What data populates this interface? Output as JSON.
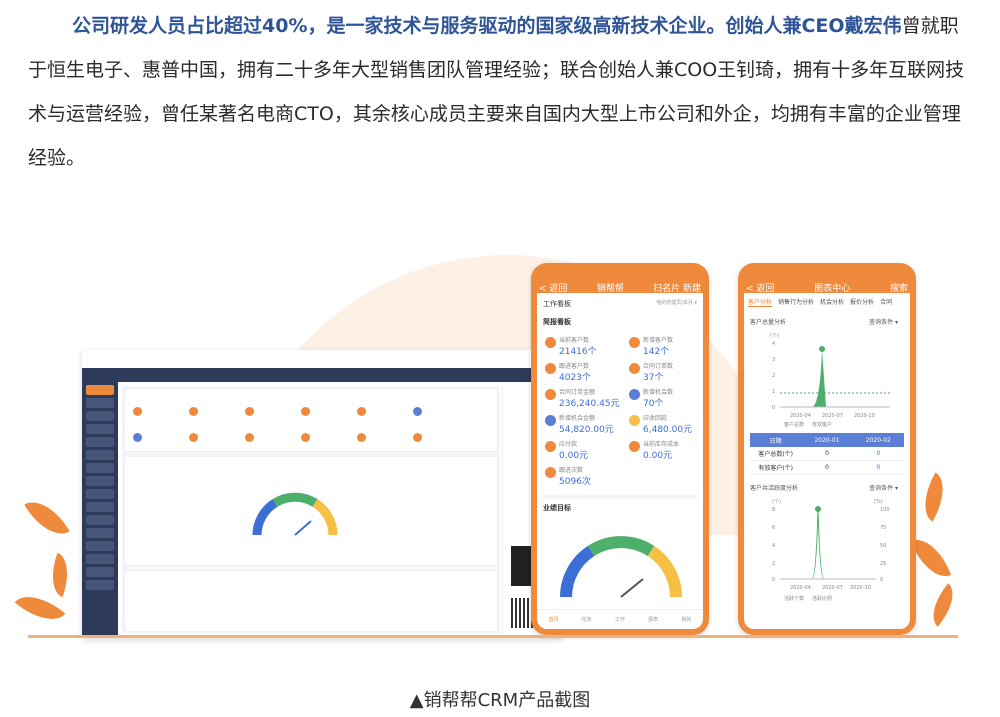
{
  "article": {
    "bold_lead": "公司研发人员占比超过40%，是一家技术与服务驱动的国家级高新技术企业。创始人兼CEO",
    "ceo_name": "戴宏伟",
    "text": "曾就职于恒生电子、惠普中国，拥有二十多年大型销售团队管理经验；联合创始人兼COO王钊琦，拥有十多年互联网技术与运营经验，曾任某著名电商CTO，其余核心成员主要来自国内大型上市公司和外企，均拥有丰富的企业管理经验。"
  },
  "phone1": {
    "back": "< 返回",
    "title": "销帮帮",
    "right": "扫名片  新建",
    "section1": "工作看板",
    "section1_right": "他的管理员/本月 ▾",
    "section2": "简报看板",
    "kpis": [
      {
        "label": "当前客户数",
        "value": "21416个"
      },
      {
        "label": "新增客户数",
        "value": "142个"
      },
      {
        "label": "跟进客户数",
        "value": "4023个"
      },
      {
        "label": "合同订单数",
        "value": "37个"
      },
      {
        "label": "合同订单金额",
        "value": "236,240.45元"
      },
      {
        "label": "新增机会数",
        "value": "70个"
      },
      {
        "label": "新增机会金额",
        "value": "54,820.00元"
      },
      {
        "label": "应收回款",
        "value": "6,480.00元"
      },
      {
        "label": "应付款",
        "value": "0.00元"
      },
      {
        "label": "当前库存成本",
        "value": "0.00元"
      },
      {
        "label": "跟进次数",
        "value": "5096次"
      }
    ],
    "section3": "业绩目标",
    "tabs": [
      "首页",
      "任务",
      "工作",
      "报表",
      "我的"
    ]
  },
  "phone2": {
    "back": "< 返回",
    "title": "图表中心",
    "right": "搜索",
    "tabs": [
      "客户分析",
      "销售行为分析",
      "机会分析",
      "报价分析",
      "合同"
    ],
    "chart1_title": "客户总量分析",
    "chart1_filter": "查询条件 ▾",
    "chart1_unit": "(个)",
    "chart1_x": [
      "2020-01",
      "2020-04",
      "2020-07",
      "2020-10"
    ],
    "chart1_y": [
      "4",
      "3",
      "2",
      "1",
      "0"
    ],
    "chart1_legend": [
      "客户总数",
      "有效客户"
    ],
    "table_head": [
      "日期",
      "2020-01",
      "2020-02"
    ],
    "table_rows": [
      {
        "label": "客户总数(个)",
        "a": "0",
        "b": "0"
      },
      {
        "label": "有效客户(个)",
        "a": "0",
        "b": "0"
      }
    ],
    "chart2_title": "客户共活跃度分析",
    "chart2_filter": "查询条件 ▾",
    "chart2_units": [
      "(个)",
      "(%)"
    ],
    "chart2_y": [
      "8",
      "6",
      "4",
      "2",
      "0"
    ],
    "chart2_y2": [
      "100",
      "75",
      "50",
      "25",
      "0"
    ],
    "chart2_x": [
      "2020-01",
      "2020-04",
      "2020-07",
      "2020-10"
    ],
    "chart2_legend": [
      "活跃个数",
      "活跃比例"
    ]
  },
  "caption": "▲销帮帮CRM产品截图",
  "colors": {
    "accent": "#ef8a3d",
    "navy": "#2d3a5a",
    "blue": "#2f5597",
    "green": "#4caf6a"
  }
}
